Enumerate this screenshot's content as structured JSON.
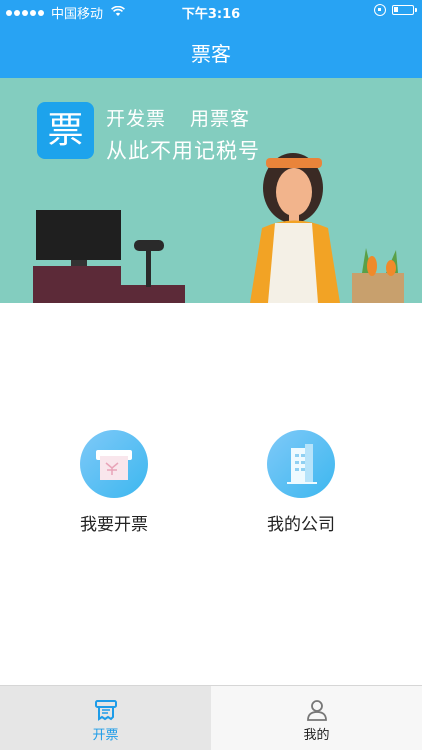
{
  "status_bar": {
    "carrier": "中国移动",
    "time": "下午3:16",
    "battery_level": 0.25,
    "signal_bars": 5
  },
  "nav": {
    "title": "票客"
  },
  "banner": {
    "logo_char": "票",
    "slogan_line1_a": "开发票",
    "slogan_line1_b": "用票客",
    "slogan_line2": "从此不用记税号"
  },
  "features": [
    {
      "label": "我要开票",
      "icon": "invoice-printer-icon"
    },
    {
      "label": "我的公司",
      "icon": "company-building-icon"
    }
  ],
  "tabs": [
    {
      "label": "开票",
      "icon": "invoice-tab-icon",
      "active": true
    },
    {
      "label": "我的",
      "icon": "person-icon",
      "active": false
    }
  ],
  "colors": {
    "primary": "#28a3f3",
    "banner_bg": "#83cdbf",
    "active_tab": "#1e9ce8"
  }
}
